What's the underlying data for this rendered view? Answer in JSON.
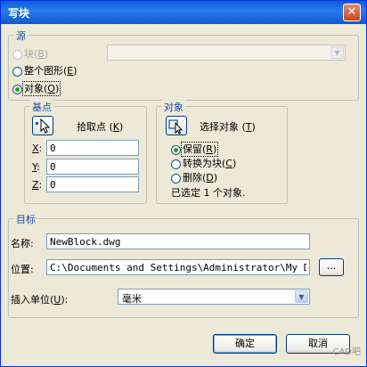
{
  "window": {
    "title": "写块",
    "close_glyph": "✕"
  },
  "source": {
    "caption": "源",
    "block_option": {
      "label": "块",
      "key": "B"
    },
    "entire_drawing_option": {
      "label": "整个图形",
      "key": "E"
    },
    "objects_option": {
      "label": "对象",
      "key": "O"
    },
    "block_combo_value": ""
  },
  "basepoint": {
    "caption": "基点",
    "pick_button_label": "拾取点",
    "pick_key": "K",
    "x_label": "X",
    "x_value": "0",
    "y_label": "Y",
    "y_value": "0",
    "z_label": "Z",
    "z_value": "0"
  },
  "objects": {
    "caption": "对象",
    "select_button_label": "选择对象",
    "select_key": "T",
    "retain_option": {
      "label": "保留",
      "key": "R"
    },
    "convert_option": {
      "label": "转换为块",
      "key": "C"
    },
    "delete_option": {
      "label": "删除",
      "key": "D"
    },
    "status": "已选定 1 个对象."
  },
  "target": {
    "caption": "目标",
    "name_label": "名称:",
    "name_value": "NewBlock.dwg",
    "location_label": "位置:",
    "location_value": "C:\\Documents and Settings\\Administrator\\My Documents",
    "browse_label": "...",
    "units_label": "插入单位",
    "units_key": "U",
    "units_value": "毫米"
  },
  "buttons": {
    "ok": "确定",
    "cancel": "取消"
  },
  "watermark": "CAD吧",
  "icons": [
    "close-icon",
    "pick-point-icon",
    "select-objects-icon",
    "dropdown-arrow-icon"
  ]
}
